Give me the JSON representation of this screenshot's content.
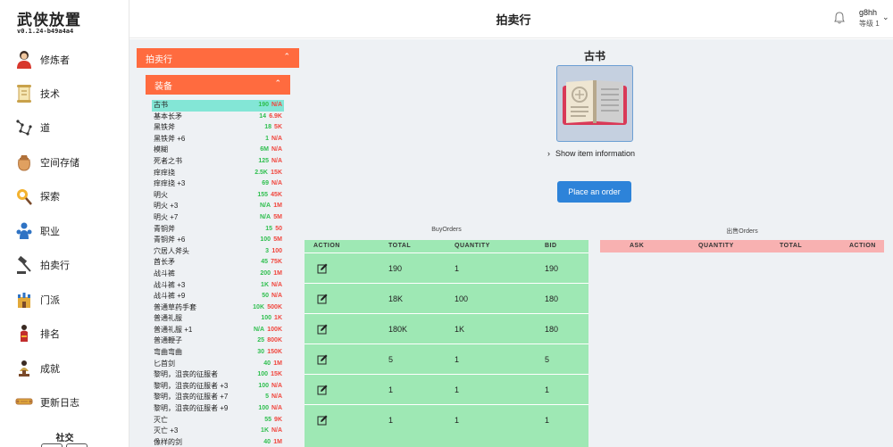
{
  "app": {
    "title": "武侠放置",
    "version": "v0.1.24-b49a4a4"
  },
  "sidebar": {
    "items": [
      {
        "label": "修炼者",
        "icon": "cultivator-icon"
      },
      {
        "label": "技术",
        "icon": "scroll-icon"
      },
      {
        "label": "道",
        "icon": "constellation-icon"
      },
      {
        "label": "空间存储",
        "icon": "bag-icon"
      },
      {
        "label": "探索",
        "icon": "explore-icon"
      },
      {
        "label": "职业",
        "icon": "profession-icon"
      },
      {
        "label": "拍卖行",
        "icon": "gavel-icon"
      },
      {
        "label": "门派",
        "icon": "castle-icon"
      },
      {
        "label": "排名",
        "icon": "rank-icon"
      },
      {
        "label": "成就",
        "icon": "trophy-icon"
      },
      {
        "label": "更新日志",
        "icon": "log-icon"
      }
    ],
    "social_label": "社交"
  },
  "header": {
    "title": "拍卖行",
    "user_name": "g8hh",
    "user_level": "等级 1"
  },
  "panels": {
    "auction_label": "拍卖行",
    "equipment_label": "装备"
  },
  "items": [
    {
      "name": "古书",
      "bid": "190",
      "ask": "N/A"
    },
    {
      "name": "基本长矛",
      "bid": "14",
      "ask": "6.9K"
    },
    {
      "name": "黑铁斧",
      "bid": "18",
      "ask": "5K"
    },
    {
      "name": "黑铁斧 +6",
      "bid": "1",
      "ask": "N/A"
    },
    {
      "name": "模糊",
      "bid": "6M",
      "ask": "N/A"
    },
    {
      "name": "死者之书",
      "bid": "125",
      "ask": "N/A"
    },
    {
      "name": "痒痒挠",
      "bid": "2.5K",
      "ask": "15K"
    },
    {
      "name": "痒痒挠 +3",
      "bid": "69",
      "ask": "N/A"
    },
    {
      "name": "明火",
      "bid": "155",
      "ask": "45K"
    },
    {
      "name": "明火 +3",
      "bid": "N/A",
      "ask": "1M"
    },
    {
      "name": "明火 +7",
      "bid": "N/A",
      "ask": "5M"
    },
    {
      "name": "青铜斧",
      "bid": "15",
      "ask": "50"
    },
    {
      "name": "青铜斧 +6",
      "bid": "100",
      "ask": "5M"
    },
    {
      "name": "穴居人斧头",
      "bid": "3",
      "ask": "100"
    },
    {
      "name": "酋长矛",
      "bid": "45",
      "ask": "75K"
    },
    {
      "name": "战斗裤",
      "bid": "200",
      "ask": "1M"
    },
    {
      "name": "战斗裤 +3",
      "bid": "1K",
      "ask": "N/A"
    },
    {
      "name": "战斗裤 +9",
      "bid": "50",
      "ask": "N/A"
    },
    {
      "name": "普通草药手套",
      "bid": "10K",
      "ask": "500K"
    },
    {
      "name": "普通礼服",
      "bid": "100",
      "ask": "1K"
    },
    {
      "name": "普通礼服 +1",
      "bid": "N/A",
      "ask": "100K"
    },
    {
      "name": "普通鞭子",
      "bid": "25",
      "ask": "800K"
    },
    {
      "name": "弯曲弯曲",
      "bid": "30",
      "ask": "150K"
    },
    {
      "name": "匕首剑",
      "bid": "40",
      "ask": "1M"
    },
    {
      "name": "黎明，沮丧的征服者",
      "bid": "100",
      "ask": "15K"
    },
    {
      "name": "黎明，沮丧的征服者 +3",
      "bid": "100",
      "ask": "N/A"
    },
    {
      "name": "黎明，沮丧的征服者 +7",
      "bid": "5",
      "ask": "N/A"
    },
    {
      "name": "黎明，沮丧的征服者 +9",
      "bid": "100",
      "ask": "N/A"
    },
    {
      "name": "灭亡",
      "bid": "55",
      "ask": "9K"
    },
    {
      "name": "灭亡 +3",
      "bid": "1K",
      "ask": "N/A"
    },
    {
      "name": "像样的剑",
      "bid": "40",
      "ask": "1M"
    }
  ],
  "detail": {
    "title": "古书",
    "show_info": "Show item information",
    "place_order": "Place an order"
  },
  "buy_orders": {
    "title": "BuyOrders",
    "headers": [
      "ACTION",
      "TOTAL",
      "QUANTITY",
      "BID"
    ],
    "rows": [
      {
        "total": "190",
        "quantity": "1",
        "bid": "190"
      },
      {
        "total": "18K",
        "quantity": "100",
        "bid": "180"
      },
      {
        "total": "180K",
        "quantity": "1K",
        "bid": "180"
      },
      {
        "total": "5",
        "quantity": "1",
        "bid": "5"
      },
      {
        "total": "1",
        "quantity": "1",
        "bid": "1"
      },
      {
        "total": "1",
        "quantity": "1",
        "bid": "1"
      }
    ]
  },
  "sell_orders": {
    "title": "出售Orders",
    "headers": [
      "ASK",
      "QUANTITY",
      "TOTAL",
      "ACTION"
    ]
  },
  "colors": {
    "accent": "#ff6b3f",
    "buy_table": "#9ee8b4",
    "sell_header": "#f8b1b1",
    "button": "#2d83d9",
    "bid_green": "#2fbf4f",
    "ask_red": "#f0463d",
    "selected_row": "#83e6d6"
  }
}
